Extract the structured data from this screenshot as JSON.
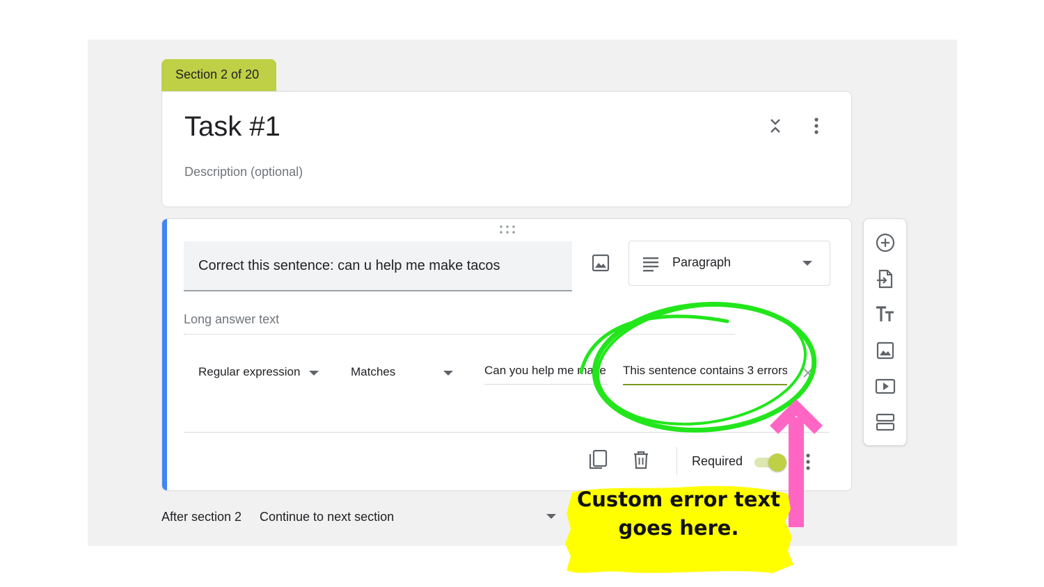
{
  "section_tab": {
    "label": "Section 2 of 20"
  },
  "title_card": {
    "title": "Task #1",
    "description_placeholder": "Description (optional)"
  },
  "question": {
    "text": "Correct this sentence: can u help me make tacos",
    "type_label": "Paragraph",
    "answer_placeholder": "Long answer text",
    "validation": {
      "type": "Regular expression",
      "operator": "Matches",
      "pattern": "Can you help me make tacos?",
      "error_text": "This sentence contains 3 errors."
    },
    "required_label": "Required",
    "required": true
  },
  "after_section": {
    "label": "After section 2",
    "value": "Continue to next section"
  },
  "toolbar": {
    "icons": [
      "add-question-icon",
      "import-questions-icon",
      "add-title-icon",
      "add-image-icon",
      "add-video-icon",
      "add-section-icon"
    ]
  },
  "annotation": {
    "line1": "Custom error text",
    "line2": "goes here.",
    "colors": {
      "highlight_circle": "#22e61b",
      "arrow": "#ff66c4",
      "callout_bg": "#ffff00"
    }
  },
  "colors": {
    "accent_blue": "#4285f4",
    "theme_green": "#bfd046"
  }
}
